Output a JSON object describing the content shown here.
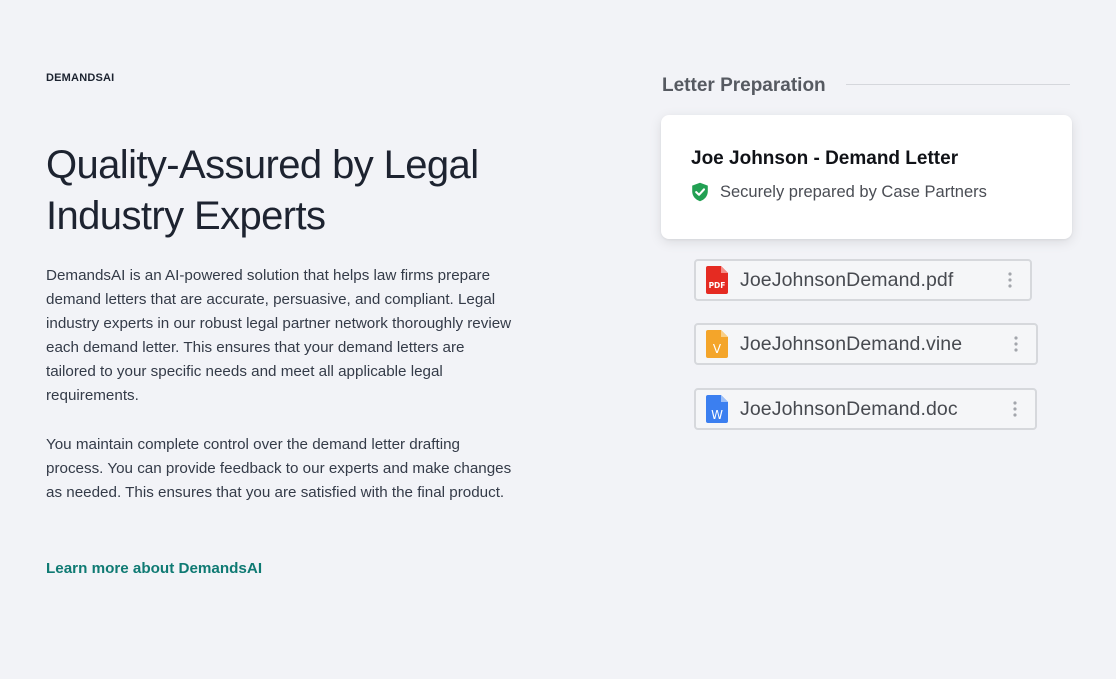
{
  "brand": "DEMANDSAI",
  "heading": "Quality-Assured by Legal Industry Experts",
  "paragraphs": [
    "DemandsAI is an AI-powered solution that helps law firms prepare demand letters that are accurate, persuasive, and compliant. Legal industry experts in our robust legal partner network thoroughly review each demand letter. This ensures that your demand letters are tailored to your specific needs and meet all applicable legal requirements.",
    "You maintain complete control over the demand letter drafting process. You can provide feedback to our experts and make changes as needed. This ensures that you are satisfied with the final product."
  ],
  "learn_more": "Learn more about DemandsAI",
  "preparation": {
    "title": "Letter Preparation",
    "card": {
      "title": "Joe Johnson - Demand Letter",
      "subtitle": "Securely prepared by Case Partners",
      "icon": "shield-check-icon",
      "icon_color": "#22a053"
    },
    "files": [
      {
        "name": "JoeJohnsonDemand.pdf",
        "type": "pdf",
        "icon": "pdf-file-icon",
        "color": "#e52b22"
      },
      {
        "name": "JoeJohnsonDemand.vine",
        "type": "vine",
        "icon": "vine-file-icon",
        "color": "#f4a52a"
      },
      {
        "name": "JoeJohnsonDemand.doc",
        "type": "doc",
        "icon": "word-file-icon",
        "color": "#3b7ff0"
      }
    ]
  },
  "colors": {
    "background": "#f2f3f7",
    "link": "#0f7a73",
    "text": "#1f2430"
  }
}
